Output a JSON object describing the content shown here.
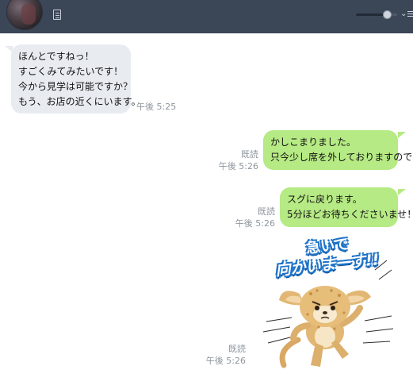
{
  "header": {
    "volume_level": 0.82
  },
  "messages": [
    {
      "direction": "incoming",
      "text": "ほんとですねっ！\nすごくみてみたいです！\n今から見学は可能ですか？\nもう、お店の近くにいます。",
      "time": "午後 5:25"
    },
    {
      "direction": "outgoing",
      "text": "かしこまりました。\n只今少し席を外しておりますので",
      "read": "既読",
      "time": "午後 5:26"
    },
    {
      "direction": "outgoing",
      "text": "スグに戻ります。\n5分ほどお待ちくださいませ！",
      "read": "既読",
      "time": "午後 5:26"
    },
    {
      "direction": "outgoing",
      "type": "sticker",
      "sticker_text_line1": "急いで",
      "sticker_text_line2": "向かいまーす!!",
      "read": "既読",
      "time": "午後 5:26"
    }
  ]
}
